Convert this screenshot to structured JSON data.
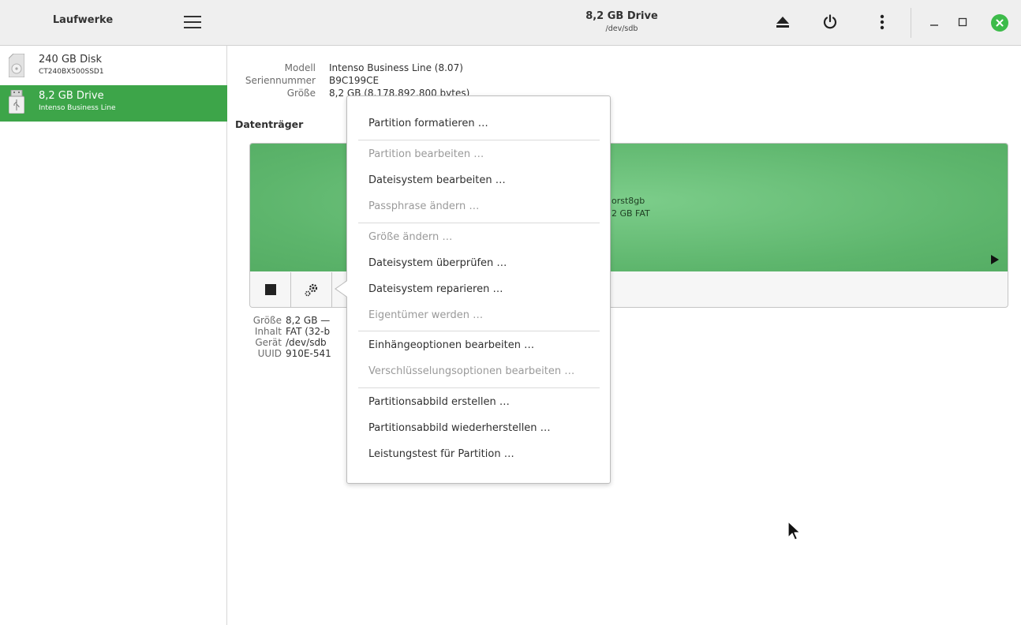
{
  "sidebar": {
    "title": "Laufwerke",
    "menu_icon": "hamburger-icon",
    "drives": [
      {
        "name": "240 GB Disk",
        "model": "CT240BX500SSD1",
        "icon": "disk-icon"
      },
      {
        "name": "8,2 GB Drive",
        "model": "Intenso Business Line",
        "icon": "usb-drive-icon",
        "selected": true
      }
    ]
  },
  "header": {
    "title": "8,2 GB Drive",
    "subtitle": "/dev/sdb",
    "buttons": [
      "eject-icon",
      "power-icon",
      "more-options-icon",
      "minimize-icon",
      "maximize-icon",
      "close-icon"
    ]
  },
  "drive_info": {
    "model_label": "Modell",
    "model_value": "Intenso Business Line (8.07)",
    "serial_label": "Seriennummer",
    "serial_value": "B9C199CE",
    "size_label": "Größe",
    "size_value": "8,2 GB (8.178.892.800 bytes)"
  },
  "volumes": {
    "section_title": "Datenträger",
    "partition_name": "orst8gb",
    "partition_size": "2 GB FAT",
    "stop_icon": "stop-icon",
    "settings_icon": "gears-icon"
  },
  "volume_info": {
    "size_label": "Größe",
    "size_value": "8,2 GB —",
    "content_label": "Inhalt",
    "content_value": "FAT (32-b",
    "device_label": "Gerät",
    "device_value": "/dev/sdb",
    "uuid_label": "UUID",
    "uuid_value": "910E-541"
  },
  "menu": {
    "items": [
      {
        "label": "Partition formatieren …",
        "enabled": true
      },
      {
        "label": "Partition bearbeiten …",
        "enabled": false
      },
      {
        "label": "Dateisystem bearbeiten …",
        "enabled": true
      },
      {
        "label": "Passphrase ändern …",
        "enabled": false
      },
      {
        "label": "Größe ändern …",
        "enabled": false
      },
      {
        "label": "Dateisystem überprüfen …",
        "enabled": true
      },
      {
        "label": "Dateisystem reparieren …",
        "enabled": true
      },
      {
        "label": "Eigentümer werden …",
        "enabled": false
      },
      {
        "label": "Einhängeoptionen bearbeiten …",
        "enabled": true
      },
      {
        "label": "Verschlüsselungsoptionen bearbeiten …",
        "enabled": false
      },
      {
        "label": "Partitionsabbild erstellen …",
        "enabled": true
      },
      {
        "label": "Partitionsabbild wiederherstellen …",
        "enabled": true
      },
      {
        "label": "Leistungstest für Partition …",
        "enabled": true
      }
    ]
  },
  "colors": {
    "accent": "#3da549",
    "partition": "#6cbf7a",
    "close_button": "#3dbb4a"
  }
}
